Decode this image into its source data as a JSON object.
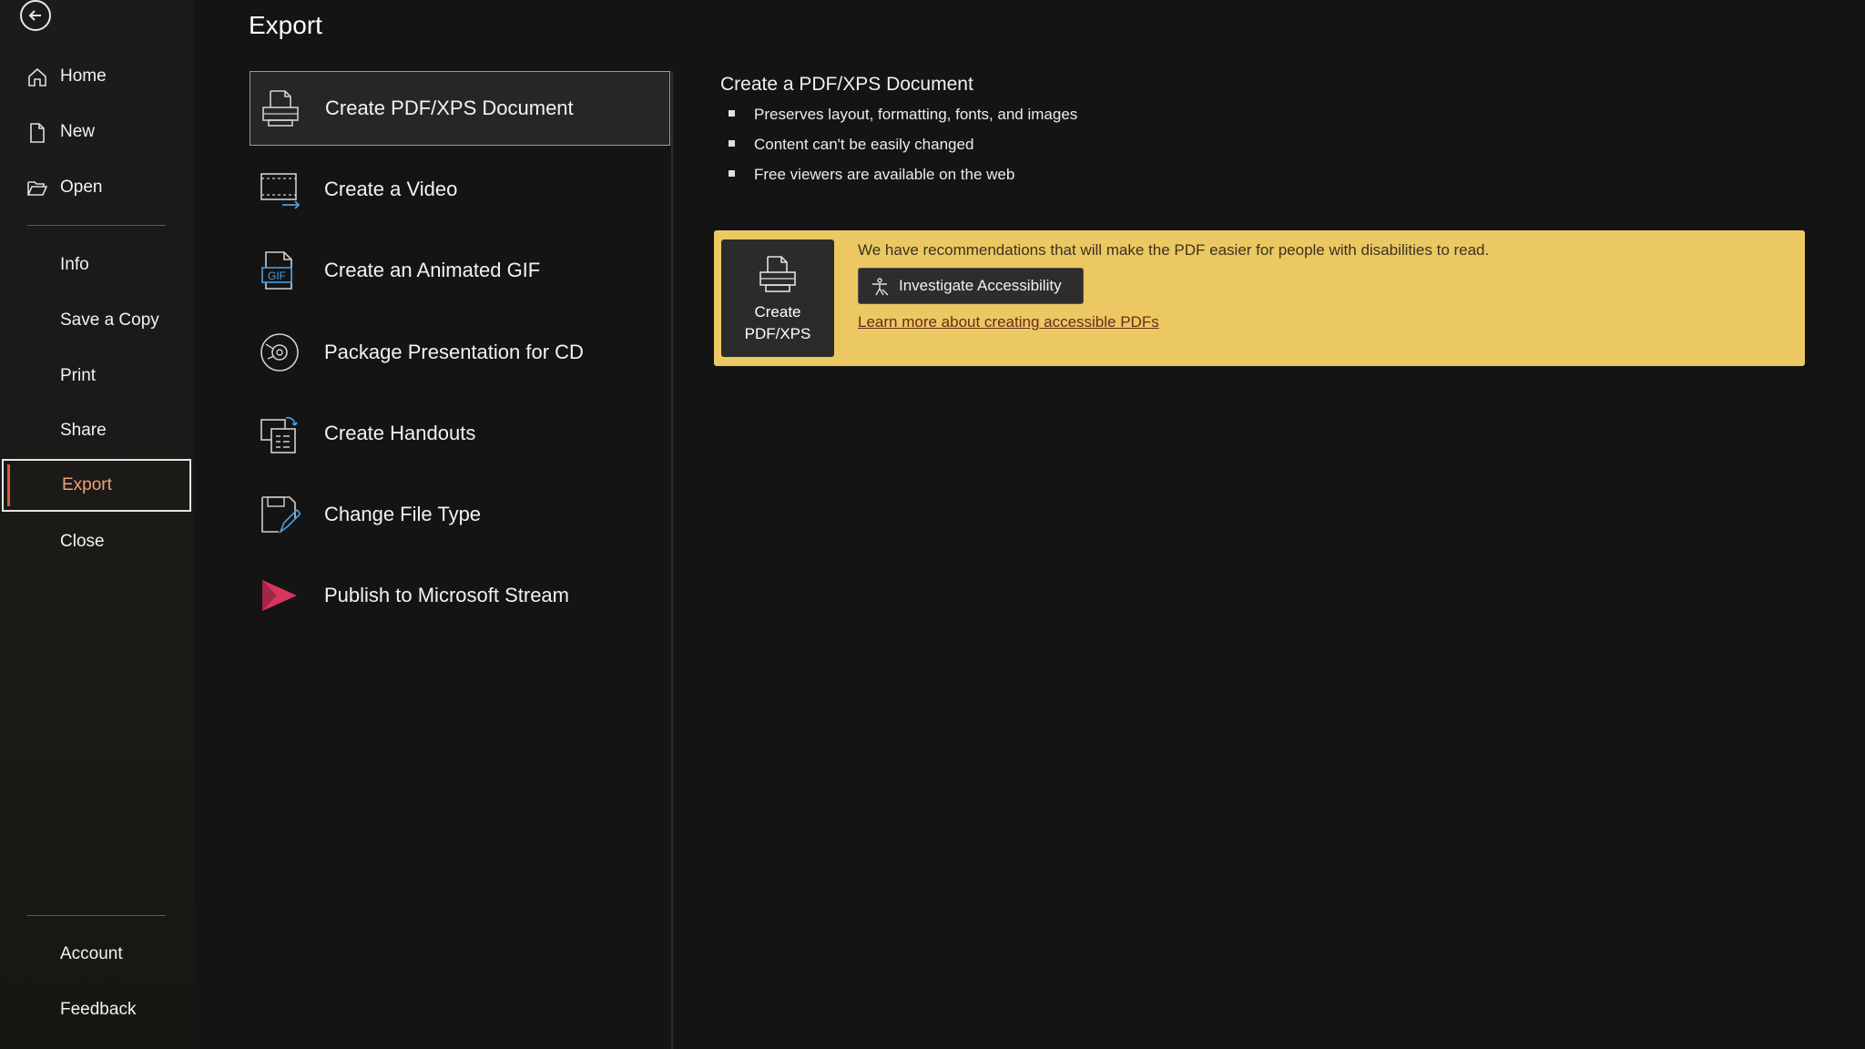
{
  "sidebar": {
    "items": [
      {
        "label": "Home",
        "icon": "home-icon"
      },
      {
        "label": "New",
        "icon": "new-document-icon"
      },
      {
        "label": "Open",
        "icon": "folder-open-icon"
      },
      {
        "label": "Info"
      },
      {
        "label": "Save a Copy"
      },
      {
        "label": "Print"
      },
      {
        "label": "Share"
      },
      {
        "label": "Export",
        "active": true
      },
      {
        "label": "Close"
      },
      {
        "label": "Account"
      },
      {
        "label": "Feedback"
      }
    ]
  },
  "page": {
    "title": "Export"
  },
  "export_options": [
    {
      "label": "Create PDF/XPS Document",
      "icon": "pdf-document-icon",
      "selected": true
    },
    {
      "label": "Create a Video",
      "icon": "video-icon"
    },
    {
      "label": "Create an Animated GIF",
      "icon": "gif-icon"
    },
    {
      "label": "Package Presentation for CD",
      "icon": "cd-icon"
    },
    {
      "label": "Create Handouts",
      "icon": "handouts-icon"
    },
    {
      "label": "Change File Type",
      "icon": "change-file-type-icon"
    },
    {
      "label": "Publish to Microsoft Stream",
      "icon": "microsoft-stream-icon"
    }
  ],
  "detail": {
    "title": "Create a PDF/XPS Document",
    "bullets": [
      "Preserves layout, formatting, fonts, and images",
      "Content can't be easily changed",
      "Free viewers are available on the web"
    ]
  },
  "banner": {
    "create_label": "Create\nPDF/XPS",
    "message": "We have recommendations that will make the PDF easier for people with disabilities to read.",
    "investigate_label": "Investigate Accessibility",
    "learn_link": "Learn more about creating accessible PDFs",
    "colors": {
      "background": "#ecc862",
      "link": "#6b2a17"
    }
  },
  "colors": {
    "app_background": "#141414",
    "accent": "#d9593a",
    "active_label": "#f0a07c"
  }
}
